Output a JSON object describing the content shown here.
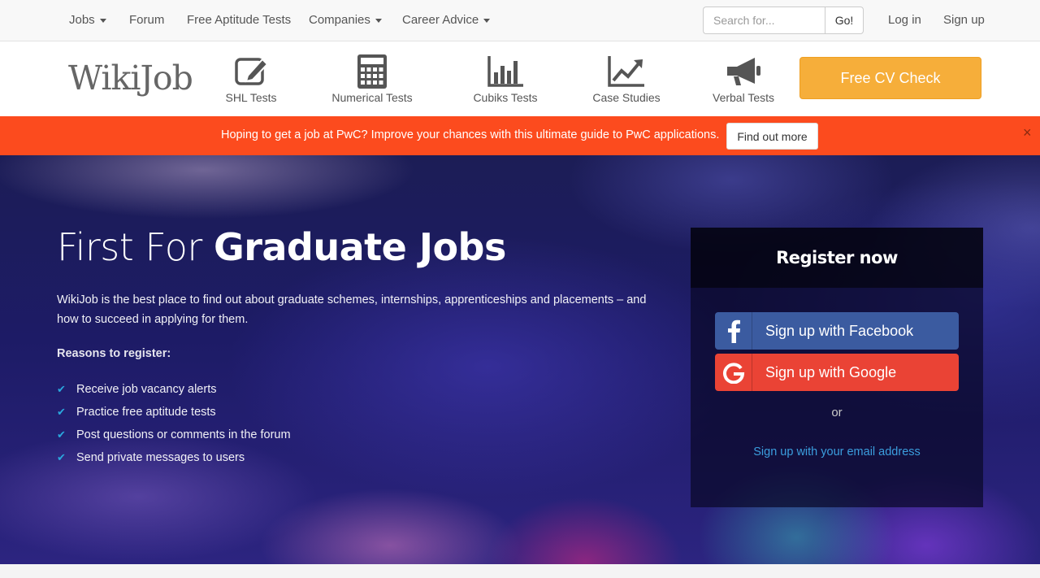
{
  "topnav": {
    "jobs": "Jobs",
    "forum": "Forum",
    "aptitude": "Free Aptitude Tests",
    "companies": "Companies",
    "career_advice": "Career Advice",
    "search_placeholder": "Search for...",
    "go": "Go!",
    "login": "Log in",
    "signup": "Sign up"
  },
  "header": {
    "logo": "WikiJob",
    "categories": [
      {
        "label": "SHL Tests",
        "icon": "pencil-square-icon"
      },
      {
        "label": "Numerical Tests",
        "icon": "calculator-icon"
      },
      {
        "label": "Cubiks Tests",
        "icon": "bar-chart-icon"
      },
      {
        "label": "Case Studies",
        "icon": "line-chart-icon"
      },
      {
        "label": "Verbal Tests",
        "icon": "megaphone-icon"
      }
    ],
    "cv_button": "Free CV Check"
  },
  "banner": {
    "text": "Hoping to get a job at PwC? Improve your chances with this ultimate guide to PwC applications.",
    "button": "Find out more",
    "close": "×",
    "color": "#fc4b1e"
  },
  "hero": {
    "title_light": "First For ",
    "title_bold": "Graduate Jobs",
    "description": "WikiJob is the best place to find out about graduate schemes, internships, apprenticeships and placements – and how to succeed in applying for them.",
    "reasons_title": "Reasons to register:",
    "reasons": [
      "Receive job vacancy alerts",
      "Practice free aptitude tests",
      "Post questions or comments in the forum",
      "Send private messages to users"
    ]
  },
  "register": {
    "title": "Register now",
    "facebook": "Sign up with Facebook",
    "google": "Sign up with Google",
    "or": "or",
    "email_link": "Sign up with your email address"
  },
  "colors": {
    "accent": "#f6ae3a",
    "facebook": "#3b5ba0",
    "google": "#ea4335",
    "link": "#3b9ede",
    "check": "#2aa8de"
  }
}
